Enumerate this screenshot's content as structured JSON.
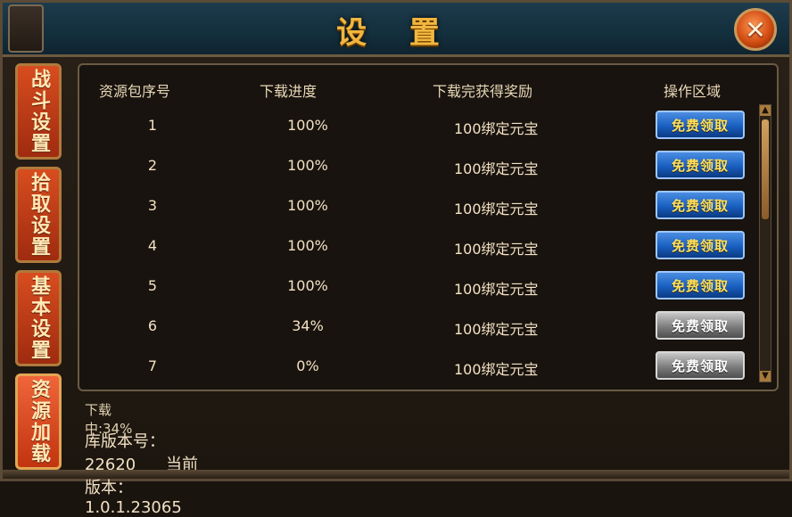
{
  "window": {
    "title": "设 置"
  },
  "sidebar": {
    "tabs": [
      {
        "label": "战斗设置"
      },
      {
        "label": "拾取设置"
      },
      {
        "label": "基本设置"
      },
      {
        "label": "资源加载"
      }
    ]
  },
  "table": {
    "headers": {
      "id": "资源包序号",
      "progress": "下载进度",
      "reward": "下载完获得奖励",
      "action": "操作区域"
    },
    "rows": [
      {
        "id": "1",
        "progress": "100%",
        "reward": "100绑定元宝",
        "button": "免费领取",
        "enabled": true
      },
      {
        "id": "2",
        "progress": "100%",
        "reward": "100绑定元宝",
        "button": "免费领取",
        "enabled": true
      },
      {
        "id": "3",
        "progress": "100%",
        "reward": "100绑定元宝",
        "button": "免费领取",
        "enabled": true
      },
      {
        "id": "4",
        "progress": "100%",
        "reward": "100绑定元宝",
        "button": "免费领取",
        "enabled": true
      },
      {
        "id": "5",
        "progress": "100%",
        "reward": "100绑定元宝",
        "button": "免费领取",
        "enabled": true
      },
      {
        "id": "6",
        "progress": "34%",
        "reward": "100绑定元宝",
        "button": "免费领取",
        "enabled": false
      },
      {
        "id": "7",
        "progress": "0%",
        "reward": "100绑定元宝",
        "button": "免费领取",
        "enabled": false
      }
    ]
  },
  "footer": {
    "downloading": "下载中:34%",
    "library_version": "库版本号：22620",
    "current_version": "当前版本：1.0.1.23065"
  },
  "icons": {
    "close": "close-icon",
    "scroll_up": "scroll-up-icon",
    "scroll_down": "scroll-down-icon"
  }
}
